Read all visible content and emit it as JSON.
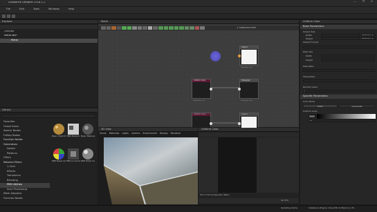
{
  "window": {
    "title": "Substance Designer 2018.1.2",
    "controls": [
      "—",
      "❐",
      "✕"
    ]
  },
  "menu": [
    "File",
    "Edit",
    "Tools",
    "Windows",
    "Help"
  ],
  "explorer": {
    "title": "Explorer",
    "items": [
      "Untitled",
      "Metal.sbs*",
      "Metal"
    ]
  },
  "graph": {
    "title": "Metal",
    "zoom": "1 Selected Item",
    "nodes": [
      {
        "title": "Output",
        "label": "512x512 - L8"
      },
      {
        "title": "Uniform Color",
        "label": "512x512 - L8"
      },
      {
        "title": "Histogram",
        "label": "512x512 - L8"
      },
      {
        "title": "Uniform Color",
        "label": ""
      },
      {
        "title": "Output",
        "label": ""
      }
    ]
  },
  "library": {
    "title": "Library",
    "search_placeholder": "Search",
    "tree": [
      "Favorites",
      "Graph Items",
      "Atomic Nodes",
      "FxMap Nodes",
      "Function Nodes",
      "Generators",
      "Noises",
      "Patterns",
      "Filters",
      "Material Filters",
      "1-Click",
      "Effects",
      "Transforms",
      "Blending",
      "PBR Utilities",
      "Scan Processing",
      "Mesh Adaptive",
      "Function Nodes"
    ],
    "thumbs": [
      "Basic Shad Metallic",
      "PBR Metallic",
      "Basic Material",
      "PBR Basecolor",
      "PBR Converter",
      "PBR Metal Velocity"
    ]
  },
  "view3d": {
    "title": "3D View",
    "menu": [
      "Scene",
      "Materials",
      "Lights",
      "Camera",
      "Environment",
      "Display",
      "Renderer"
    ]
  },
  "view2d": {
    "title": "Uniform Color",
    "status": "512 x 512 (Grayscale, 8bpc)",
    "zoom": "32.72%"
  },
  "properties": {
    "title": "Uniform Color",
    "sections": [
      {
        "name": "Base Parameters",
        "rows": [
          "Output Size",
          "Width",
          "Height",
          "Output Format",
          "Pixel Size",
          "Width",
          "Height",
          "Pixel Ratio",
          "Tiling Mode",
          "Random Seed"
        ],
        "values": {
          "width": "Relative to p",
          "height": "Relative to p",
          "seed": "0"
        }
      },
      {
        "name": "Specific Parameters",
        "rows": [
          "Color Mode",
          "Uniform Color"
        ],
        "modes": [
          "Color",
          "Grayscale"
        ],
        "value": "0.4"
      }
    ]
  },
  "status_bar": {
    "left": "Updating Cache",
    "right": "Substance Engine: Direct3D 10  Memory: 0%"
  },
  "colors": {
    "accent": "#2f7bc3",
    "node_purple": "#5a1a34",
    "node_gray": "#2a2a2a",
    "cursor": "#5d58c8"
  }
}
